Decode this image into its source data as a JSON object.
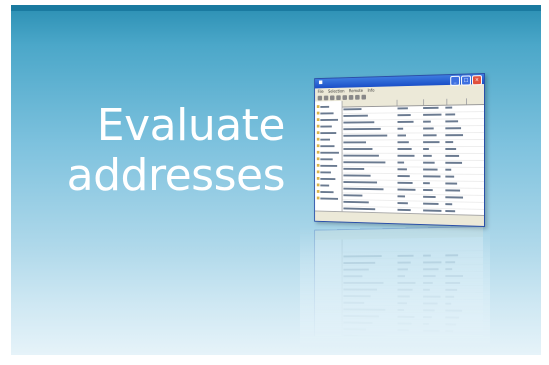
{
  "headline": {
    "line1": "Evaluate",
    "line2": "addresses"
  },
  "colors": {
    "accent_top": "#1a7aa0",
    "background_top": "#2b8fb3",
    "background_bottom": "#e6f3f9",
    "headline_text": "#ffffff"
  },
  "app_window": {
    "title_icon": "app-window-icon",
    "menu": [
      "File",
      "Selection",
      "Remote",
      "Info"
    ],
    "grid_columns": [
      "",
      "",
      "",
      ""
    ],
    "row_count": 17
  }
}
